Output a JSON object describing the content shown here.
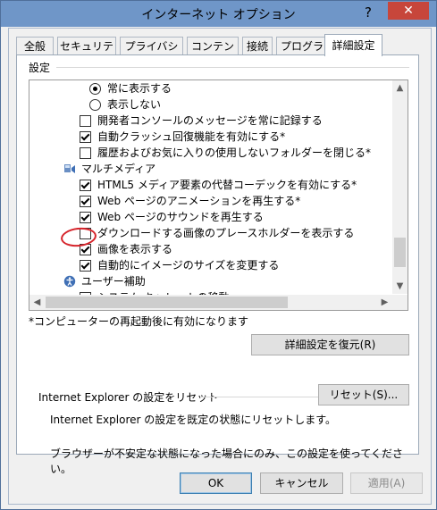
{
  "window": {
    "title": "インターネット オプション",
    "help": "?",
    "close": "✕"
  },
  "tabs": [
    "全般",
    "セキュリティ",
    "プライバシー",
    "コンテンツ",
    "接続",
    "プログラム",
    "詳細設定"
  ],
  "active_tab": "詳細設定",
  "settings": {
    "group_label": "設定",
    "items": [
      {
        "type": "radio",
        "label": "常に表示する",
        "checked": true
      },
      {
        "type": "radio",
        "label": "表示しない",
        "checked": false
      },
      {
        "type": "checkbox",
        "label": "開発者コンソールのメッセージを常に記録する",
        "checked": false
      },
      {
        "type": "checkbox",
        "label": "自動クラッシュ回復機能を有効にする*",
        "checked": true
      },
      {
        "type": "checkbox",
        "label": "履歴およびお気に入りの使用しないフォルダーを閉じる*",
        "checked": false
      },
      {
        "type": "category",
        "label": "マルチメディア",
        "icon": "multimedia-icon"
      },
      {
        "type": "checkbox",
        "label": "HTML5 メディア要素の代替コーデックを有効にする*",
        "checked": true
      },
      {
        "type": "checkbox",
        "label": "Web ページのアニメーションを再生する*",
        "checked": true
      },
      {
        "type": "checkbox",
        "label": "Web ページのサウンドを再生する",
        "checked": true
      },
      {
        "type": "checkbox",
        "label": "ダウンロードする画像のプレースホルダーを表示する",
        "checked": false
      },
      {
        "type": "checkbox",
        "label": "画像を表示する",
        "checked": true
      },
      {
        "type": "checkbox",
        "label": "自動的にイメージのサイズを変更する",
        "checked": true
      },
      {
        "type": "category",
        "label": "ユーザー補助",
        "icon": "accessibility-icon"
      },
      {
        "type": "checkbox",
        "label": "システム キャレットの移動",
        "checked": false
      }
    ],
    "note": "*コンピューターの再起動後に有効になります",
    "restore_button": "詳細設定を復元(R)"
  },
  "reset": {
    "title": "Internet Explorer の設定をリセット",
    "description": "Internet Explorer の設定を既定の状態にリセットします。",
    "button": "リセット(S)...",
    "warning": "ブラウザーが不安定な状態になった場合にのみ、この設定を使ってください。"
  },
  "footer": {
    "ok": "OK",
    "cancel": "キャンセル",
    "apply": "適用(A)"
  },
  "colors": {
    "titlebar": "#6f96c8",
    "close_button": "#c7463b",
    "annotation": "#d6242b"
  }
}
